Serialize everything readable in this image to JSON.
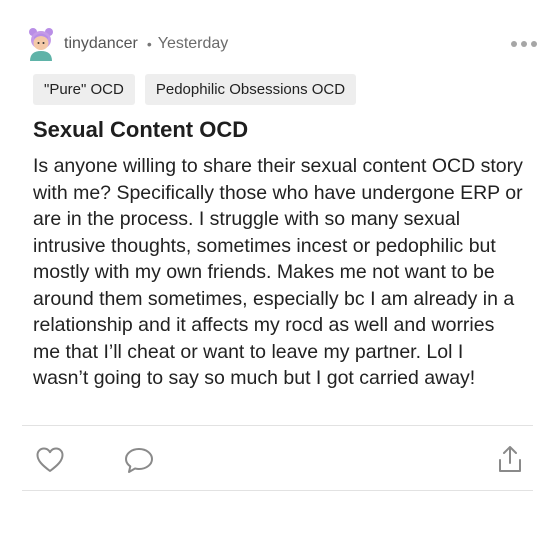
{
  "post": {
    "username": "tinydancer",
    "separator": "•",
    "timestamp": "Yesterday",
    "tags": [
      "\"Pure\" OCD",
      "Pedophilic Obsessions OCD"
    ],
    "title": "Sexual Content OCD",
    "body": "Is anyone willing to share their sexual content OCD story with me? Specifically those who have undergone ERP or are in the process. I struggle with so many sexual intrusive thoughts, sometimes incest or pedophilic but mostly with my own friends. Makes me not want to be around them sometimes, especially bc I am already in a relationship and it affects my rocd as well and worries me that I’ll cheat or want to leave my partner. Lol I wasn’t going to say so much but I got carried away!"
  },
  "icons": {
    "avatar": "avatar-illustration",
    "more": "more-horizontal-icon",
    "like": "heart-icon",
    "comment": "comment-bubble-icon",
    "share": "share-upload-icon"
  },
  "colors": {
    "tag_background": "#eeeeee",
    "avatar_hair": "#b98ee6",
    "avatar_face": "#f4c9a8",
    "icon_gray": "#8a8a8a"
  }
}
